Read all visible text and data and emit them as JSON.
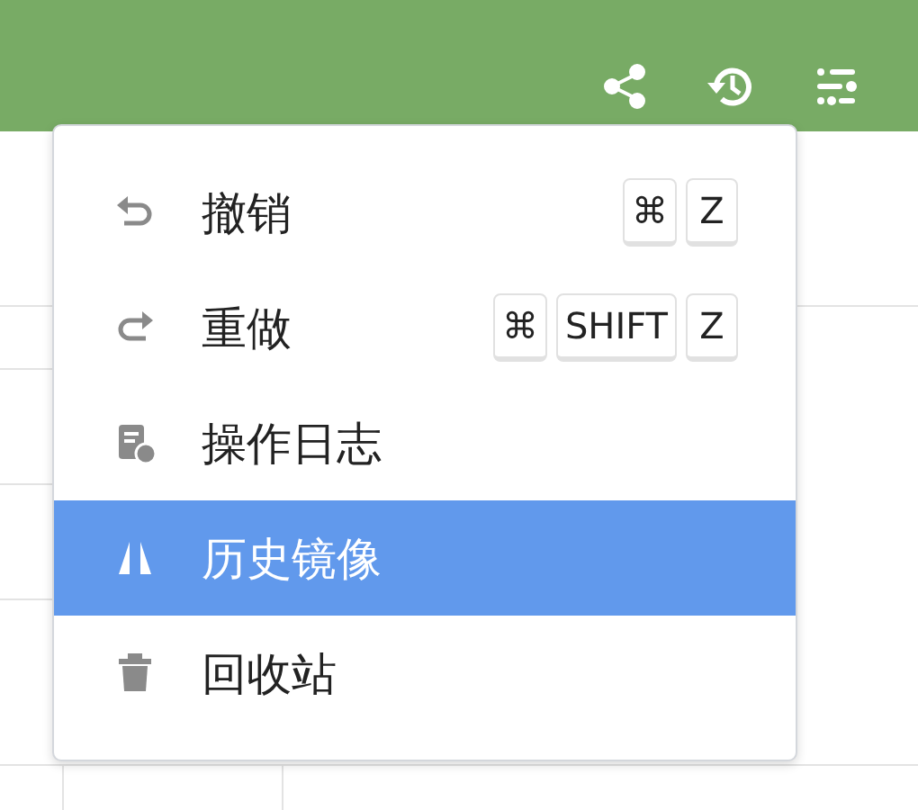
{
  "menu": {
    "items": [
      {
        "label": "撤销",
        "shortcut": [
          "⌘",
          "Z"
        ],
        "selected": false
      },
      {
        "label": "重做",
        "shortcut": [
          "⌘",
          "SHIFT",
          "Z"
        ],
        "selected": false
      },
      {
        "label": "操作日志",
        "selected": false
      },
      {
        "label": "历史镜像",
        "selected": true
      },
      {
        "label": "回收站",
        "selected": false
      }
    ]
  }
}
